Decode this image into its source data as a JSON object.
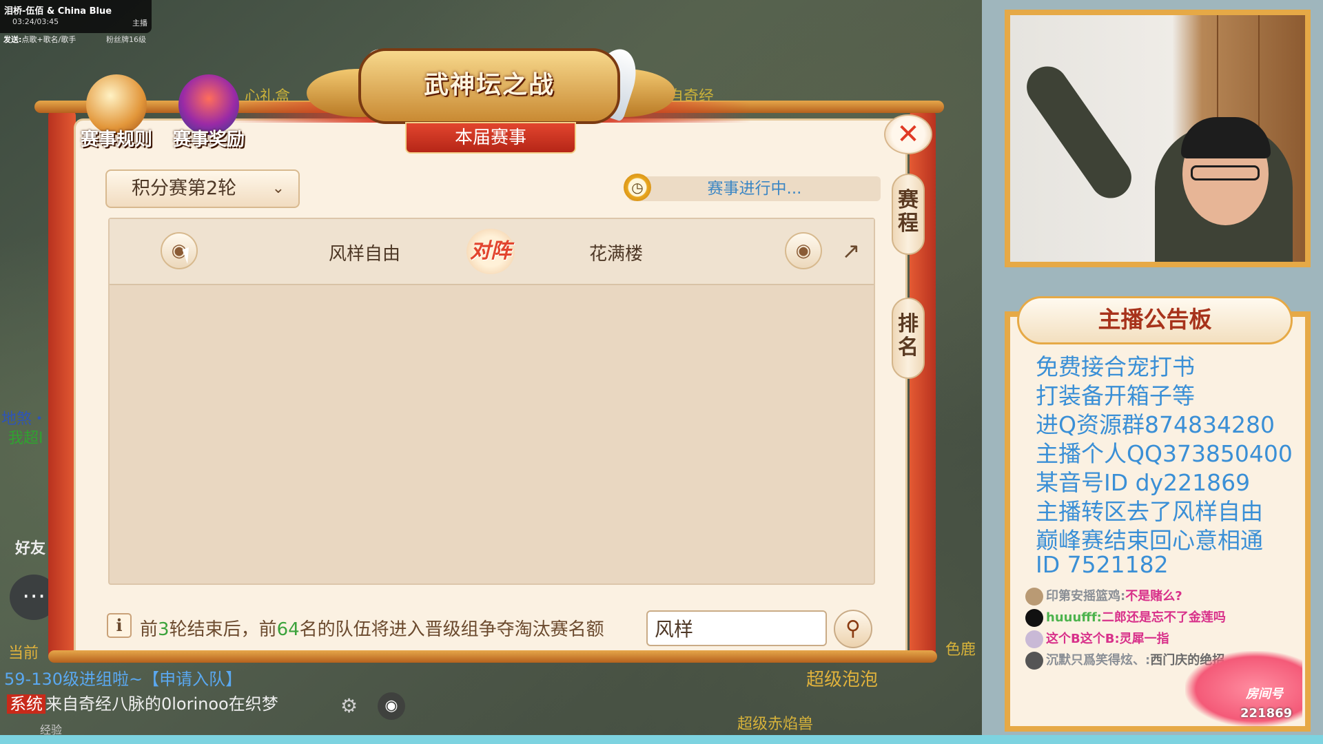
{
  "stream_overlay": {
    "music_title": "泪桥-伍佰 & China Blue",
    "music_time": "03:24/03:45",
    "music_role": "主播",
    "send_label": "发送:",
    "send_hint": "点歌+歌名/歌手",
    "fans_badge": "粉丝牌16级"
  },
  "top_icons": {
    "rules_label": "赛事规则",
    "reward_label": "赛事奖励"
  },
  "header": {
    "banner_title": "武神坛之战",
    "ribbon_label": "本届赛事"
  },
  "round_select": {
    "value": "积分赛第2轮"
  },
  "status": {
    "text": "赛事进行中..."
  },
  "match": {
    "team_left": "风样自由",
    "vs_label": "对阵",
    "team_right": "花满楼"
  },
  "side_tabs": {
    "schedule": "赛程",
    "ranking": "排名"
  },
  "footer": {
    "info_pre": "前",
    "info_n1": "3",
    "info_mid": "轮结束后，前",
    "info_n2": "64",
    "info_post": "名的队伍将进入晋级组争夺淘汰赛名额",
    "search_value": "风样"
  },
  "game_bg": {
    "left_text_1": "地煞・",
    "left_text_2": "我超I",
    "friends_label": "好友",
    "current_label": "当前",
    "group_line": "59-130级进组啦~【申请入队】",
    "system_tag": "系统",
    "system_line": "来自奇经八脉的0lorinoo在织梦",
    "bubble_text": "超级泡泡",
    "beast_text": "超级赤焰兽",
    "right_text": "色鹿",
    "exp_label": "经验",
    "top_text_1": "心礼盒",
    "top_text_2": "自奇经"
  },
  "board": {
    "title": "主播公告板",
    "lines": [
      "免费接合宠打书",
      "打装备开箱子等",
      "进Q资源群874834280",
      "主播个人QQ373850400",
      "某音号ID  dy221869",
      "主播转区去了风样自由",
      "巅峰赛结束回心意相通",
      "ID 7521182"
    ],
    "danmaku": [
      {
        "name": "印第安摇篮鸡:",
        "msg": "不是赌么?"
      },
      {
        "name": "huuufff:",
        "msg": "二郎还是忘不了金莲吗"
      },
      {
        "name": "这个B这个B:",
        "msg": "灵犀一指"
      },
      {
        "name": "沉默只爲笑得炫、:",
        "msg": "西门庆的绝招"
      }
    ],
    "room_label": "房间号",
    "room_id": "221869"
  },
  "icons": {
    "close": "close-icon",
    "eye": "eye-icon",
    "share": "share-icon",
    "search": "search-icon",
    "clock": "clock-icon",
    "info": "info-icon",
    "chevron": "chevron-down-icon"
  },
  "colors": {
    "accent_red": "#e03a25",
    "status_blue": "#3b86c4",
    "board_text_blue": "#3a8fd6",
    "number_green": "#3ba23b",
    "frame_gold": "#e6a946"
  }
}
